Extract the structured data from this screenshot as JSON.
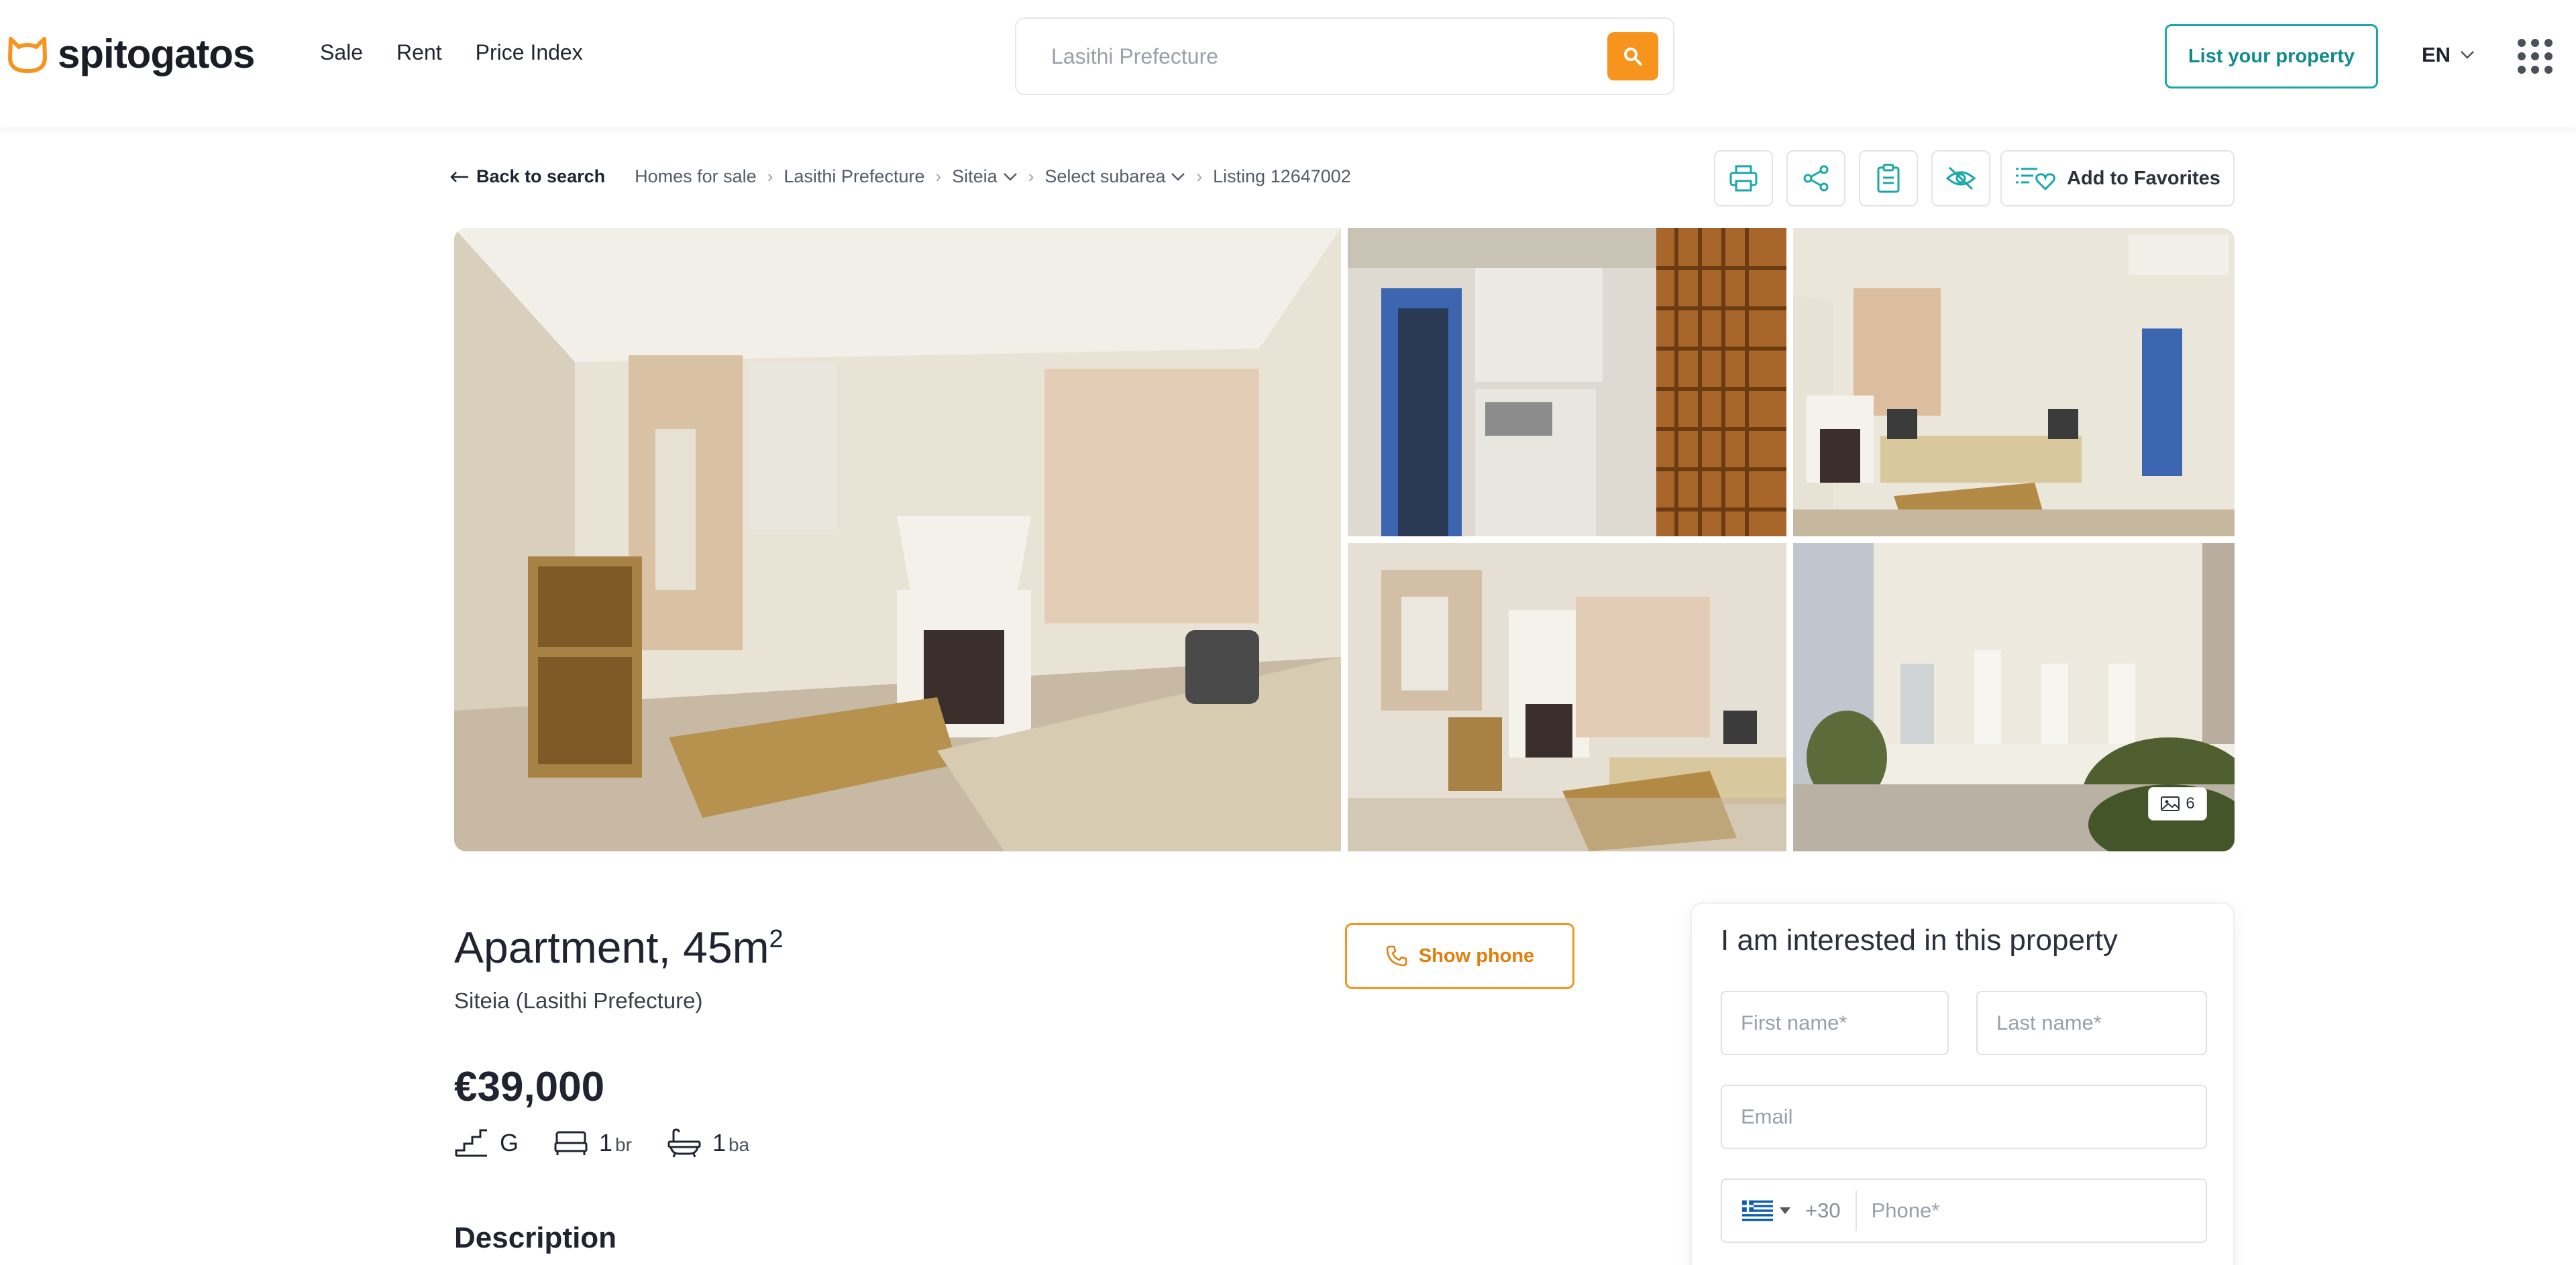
{
  "header": {
    "brand": "spitogatos",
    "nav": [
      "Sale",
      "Rent",
      "Price Index"
    ],
    "search_placeholder": "Lasithi Prefecture",
    "list_property": "List your property",
    "language": "EN",
    "accent_color": "#f7941d",
    "teal_color": "#1aa7a8"
  },
  "breadcrumb": {
    "back": "Back to search",
    "items": [
      "Homes for sale",
      "Lasithi Prefecture",
      "Siteia",
      "Select subarea",
      "Listing 12647002"
    ]
  },
  "toolbar": {
    "icons": [
      "print-icon",
      "share-icon",
      "clipboard-icon",
      "hide-icon"
    ],
    "favorites": "Add to Favorites"
  },
  "gallery": {
    "photo_count": "6"
  },
  "listing": {
    "title": "Apartment, 45m",
    "title_sup": "2",
    "location": "Siteia (Lasithi Prefecture)",
    "price": "€39,000",
    "show_phone": "Show phone",
    "floor": "G",
    "bedrooms": "1",
    "bedrooms_unit": "br",
    "bathrooms": "1",
    "bathrooms_unit": "ba",
    "description_heading": "Description"
  },
  "contact": {
    "heading": "I am interested in this property",
    "first_name": "First name*",
    "last_name": "Last name*",
    "email": "Email",
    "country_code": "+30",
    "phone": "Phone*"
  }
}
